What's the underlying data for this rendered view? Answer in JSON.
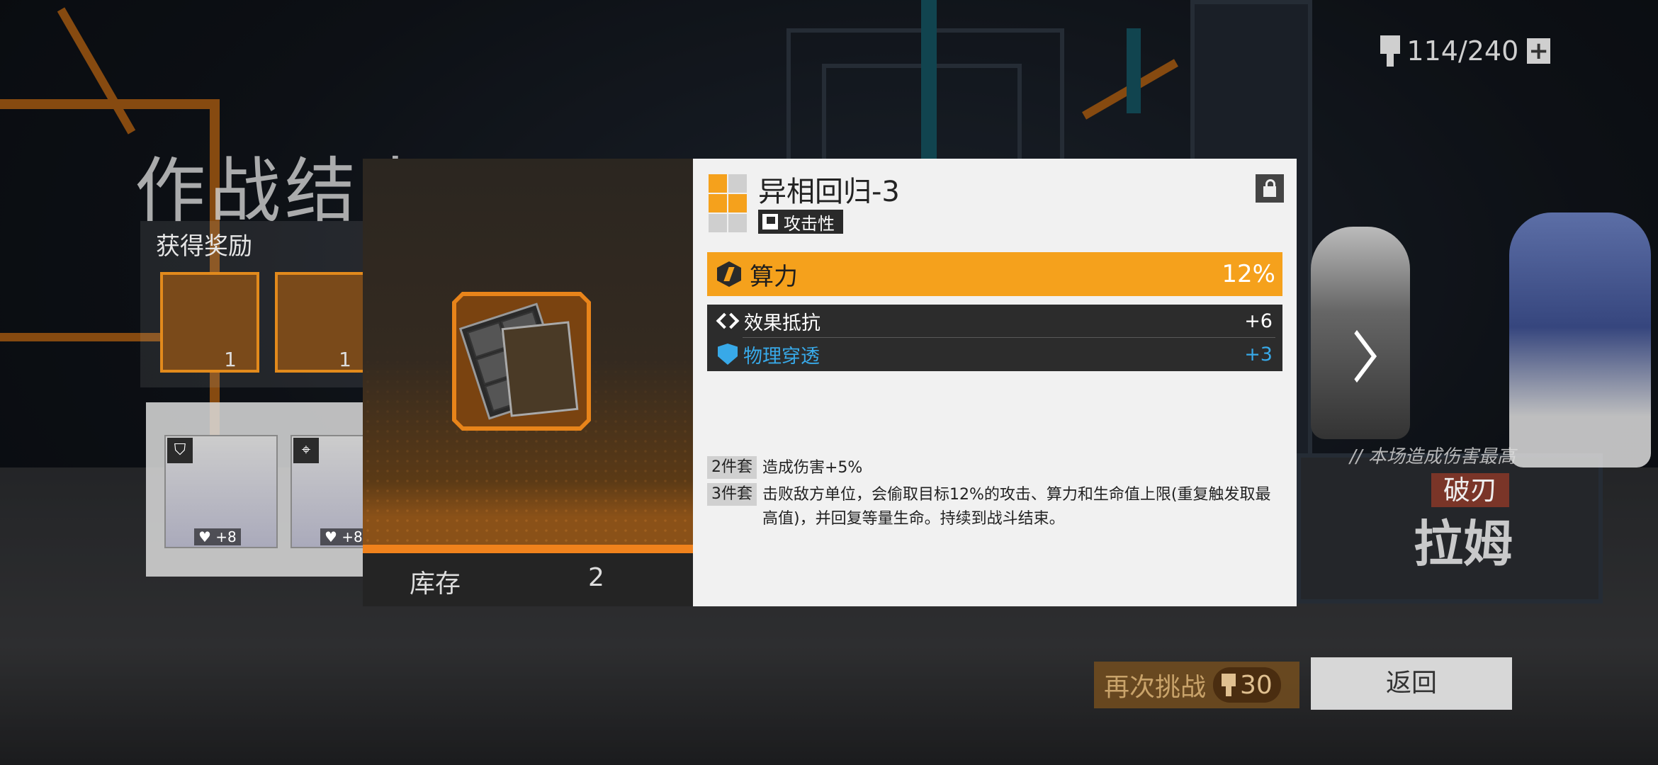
{
  "colors": {
    "accent": "#f5a11c",
    "accent_dark": "#e8841a",
    "sub_panel": "#2c2c2c",
    "physical_pen": "#38a9e8",
    "panel_light": "#f1f1f1"
  },
  "topbar": {
    "stamina": "114/240",
    "stamina_icon": "stamina-icon",
    "add_icon": "plus-icon"
  },
  "battle": {
    "title": "作战结束",
    "rewards_label": "获得奖励",
    "rewards": [
      {
        "count": "1"
      },
      {
        "count": "1"
      }
    ],
    "team": [
      {
        "heal": "♥ +8"
      },
      {
        "heal": "♥ +8"
      }
    ],
    "best_damage_label": "// 本场造成伤害最高",
    "best_title": "破刃",
    "best_name": "拉姆"
  },
  "footer": {
    "retry_label": "再次挑战",
    "retry_cost": "30",
    "back_label": "返回"
  },
  "popup": {
    "stock_label": "库存",
    "stock_value": "2",
    "item_name": "异相回归-3",
    "item_type": "攻击性",
    "lock_icon": "lock-icon",
    "main_stat": {
      "label": "算力",
      "value": "12%"
    },
    "sub_stats": [
      {
        "label": "效果抵抗",
        "value": "+6",
        "color": "#ffffff"
      },
      {
        "label": "物理穿透",
        "value": "+3",
        "color": "#38a9e8"
      }
    ],
    "set_effects": [
      {
        "tag": "2件套",
        "text": "造成伤害+5%"
      },
      {
        "tag": "3件套",
        "text": "击败敌方单位，会偷取目标12%的攻击、算力和生命值上限(重复触发取最高值)，并回复等量生命。持续到战斗结束。"
      }
    ]
  }
}
